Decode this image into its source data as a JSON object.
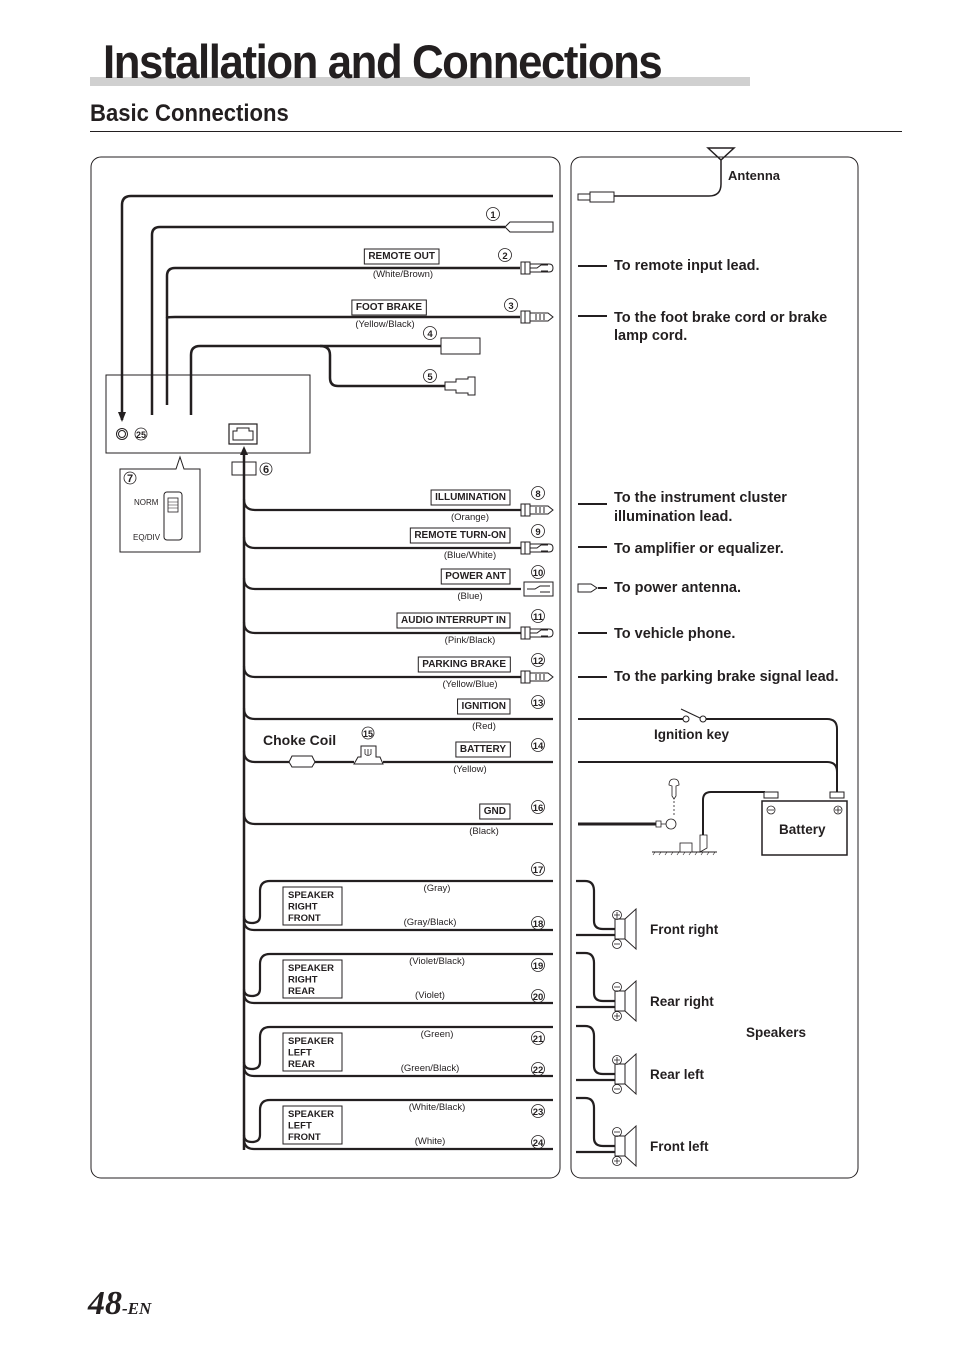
{
  "header": {
    "title": "Installation and Connections",
    "subtitle": "Basic Connections"
  },
  "unit": {
    "jack_number": "25",
    "harness_connector_number": "6",
    "switch": {
      "number": "7",
      "positions": [
        "NORM",
        "EQ/DIV"
      ]
    }
  },
  "top_leads": [
    {
      "number": "1",
      "label": "",
      "color": ""
    },
    {
      "number": "2",
      "label": "REMOTE OUT",
      "color": "(White/Brown)"
    },
    {
      "number": "3",
      "label": "FOOT BRAKE",
      "color": "(Yellow/Black)"
    },
    {
      "number": "4",
      "label": "",
      "color": ""
    },
    {
      "number": "5",
      "label": "",
      "color": ""
    }
  ],
  "harness_leads": [
    {
      "number": "8",
      "label": "ILLUMINATION",
      "color": "(Orange)",
      "destination": "To the instrument cluster illumination lead."
    },
    {
      "number": "9",
      "label": "REMOTE TURN-ON",
      "color": "(Blue/White)",
      "destination": "To amplifier or equalizer."
    },
    {
      "number": "10",
      "label": "POWER ANT",
      "color": "(Blue)",
      "destination": "To power antenna."
    },
    {
      "number": "11",
      "label": "AUDIO INTERRUPT IN",
      "color": "(Pink/Black)",
      "destination": "To vehicle phone."
    },
    {
      "number": "12",
      "label": "PARKING BRAKE",
      "color": "(Yellow/Blue)",
      "destination": "To the parking brake signal lead."
    },
    {
      "number": "13",
      "label": "IGNITION",
      "color": "(Red)"
    },
    {
      "number": "14",
      "label": "BATTERY",
      "color": "(Yellow)"
    },
    {
      "number": "16",
      "label": "GND",
      "color": "(Black)"
    }
  ],
  "fuse_number": "15",
  "choke_coil_label": "Choke Coil",
  "speaker_groups": [
    {
      "label": [
        "SPEAKER",
        "RIGHT",
        "FRONT"
      ],
      "leads": [
        {
          "number": "17",
          "color": "(Gray)"
        },
        {
          "number": "18",
          "color": "(Gray/Black)"
        }
      ]
    },
    {
      "label": [
        "SPEAKER",
        "RIGHT",
        "REAR"
      ],
      "leads": [
        {
          "number": "19",
          "color": "(Violet/Black)"
        },
        {
          "number": "20",
          "color": "(Violet)"
        }
      ]
    },
    {
      "label": [
        "SPEAKER",
        "LEFT",
        "REAR"
      ],
      "leads": [
        {
          "number": "21",
          "color": "(Green)"
        },
        {
          "number": "22",
          "color": "(Green/Black)"
        }
      ]
    },
    {
      "label": [
        "SPEAKER",
        "LEFT",
        "FRONT"
      ],
      "leads": [
        {
          "number": "23",
          "color": "(White/Black)"
        },
        {
          "number": "24",
          "color": "(White)"
        }
      ]
    }
  ],
  "right_panel": {
    "antenna": "Antenna",
    "remote_input": "To remote input lead.",
    "foot_brake": [
      "To the foot brake cord or brake",
      "lamp cord."
    ],
    "illumination": [
      "To the instrument cluster",
      "illumination lead."
    ],
    "amplifier": "To amplifier or equalizer.",
    "power_antenna": "To power antenna.",
    "vehicle_phone": "To vehicle phone.",
    "parking_brake": "To the parking brake signal lead.",
    "ignition_key": "Ignition key",
    "battery": "Battery",
    "speakers_title": "Speakers",
    "speakers": [
      "Front right",
      "Rear right",
      "Rear left",
      "Front left"
    ]
  },
  "footer": {
    "page_number": "48",
    "suffix": "-EN"
  }
}
